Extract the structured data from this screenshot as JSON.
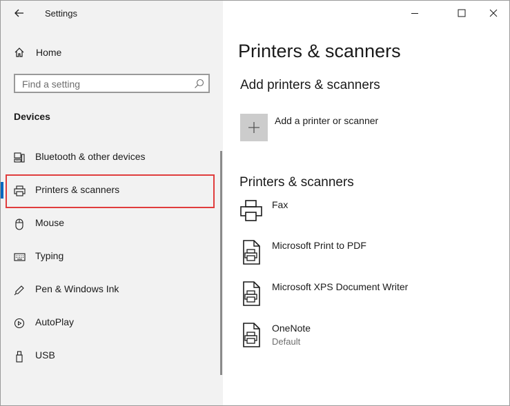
{
  "window": {
    "title": "Settings"
  },
  "sidebar": {
    "home_label": "Home",
    "search_placeholder": "Find a setting",
    "section_label": "Devices",
    "items": [
      {
        "label": "Bluetooth & other devices",
        "icon": "bluetooth-devices-icon"
      },
      {
        "label": "Printers & scanners",
        "icon": "printer-icon",
        "selected": true
      },
      {
        "label": "Mouse",
        "icon": "mouse-icon"
      },
      {
        "label": "Typing",
        "icon": "keyboard-icon"
      },
      {
        "label": "Pen & Windows Ink",
        "icon": "pen-icon"
      },
      {
        "label": "AutoPlay",
        "icon": "autoplay-icon"
      },
      {
        "label": "USB",
        "icon": "usb-icon"
      }
    ]
  },
  "main": {
    "page_title": "Printers & scanners",
    "add_section_title": "Add printers & scanners",
    "add_button_label": "Add a printer or scanner",
    "list_section_title": "Printers & scanners",
    "devices": [
      {
        "name": "Fax",
        "status": "",
        "icon": "fax-printer-icon"
      },
      {
        "name": "Microsoft Print to PDF",
        "status": "",
        "icon": "document-printer-icon"
      },
      {
        "name": "Microsoft XPS Document Writer",
        "status": "",
        "icon": "document-printer-icon"
      },
      {
        "name": "OneNote",
        "status": "Default",
        "icon": "document-printer-icon"
      }
    ]
  },
  "colors": {
    "accent": "#0067c0",
    "highlight_border": "#e03c3c",
    "sidebar_bg": "#f2f2f2"
  }
}
